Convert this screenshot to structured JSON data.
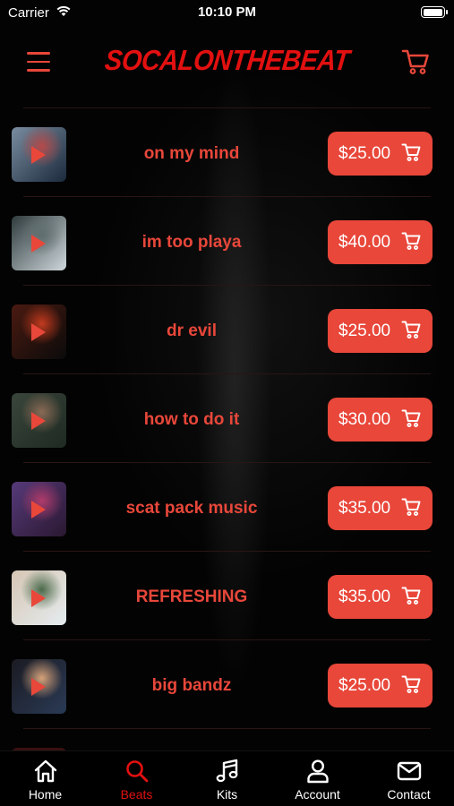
{
  "status_bar": {
    "carrier": "Carrier",
    "time": "10:10 PM"
  },
  "header": {
    "brand": "SOCALONTHEBEAT",
    "menu_icon": "hamburger-icon",
    "cart_icon": "cart-icon"
  },
  "colors": {
    "accent": "#e8473a",
    "brand": "#e21010",
    "background": "#000000"
  },
  "beats": [
    {
      "title": "on my mind",
      "price": "$25.00",
      "thumb_colors": [
        "#1b2a3c",
        "#b54a4a",
        "#7a8da0"
      ]
    },
    {
      "title": "im too playa",
      "price": "$40.00",
      "thumb_colors": [
        "#cfd8dc",
        "#5f6d6e",
        "#2e3b3d"
      ]
    },
    {
      "title": "dr evil",
      "price": "$25.00",
      "thumb_colors": [
        "#0b0b0b",
        "#c23a1e",
        "#4a1a10"
      ]
    },
    {
      "title": "how to do it",
      "price": "$30.00",
      "thumb_colors": [
        "#1e2a22",
        "#8a6a55",
        "#3a463b"
      ]
    },
    {
      "title": "scat pack music",
      "price": "$35.00",
      "thumb_colors": [
        "#2a1830",
        "#b03b6a",
        "#563a7a"
      ]
    },
    {
      "title": "REFRESHING",
      "price": "$35.00",
      "thumb_colors": [
        "#e4ecef",
        "#4a6a4a",
        "#d7c6b4"
      ]
    },
    {
      "title": "big bandz",
      "price": "$25.00",
      "thumb_colors": [
        "#2a3a55",
        "#d6a27a",
        "#1b1b22"
      ]
    }
  ],
  "tabs": [
    {
      "label": "Home",
      "icon": "home-icon",
      "active": false
    },
    {
      "label": "Beats",
      "icon": "search-icon",
      "active": true
    },
    {
      "label": "Kits",
      "icon": "music-note-icon",
      "active": false
    },
    {
      "label": "Account",
      "icon": "user-icon",
      "active": false
    },
    {
      "label": "Contact",
      "icon": "mail-icon",
      "active": false
    }
  ]
}
